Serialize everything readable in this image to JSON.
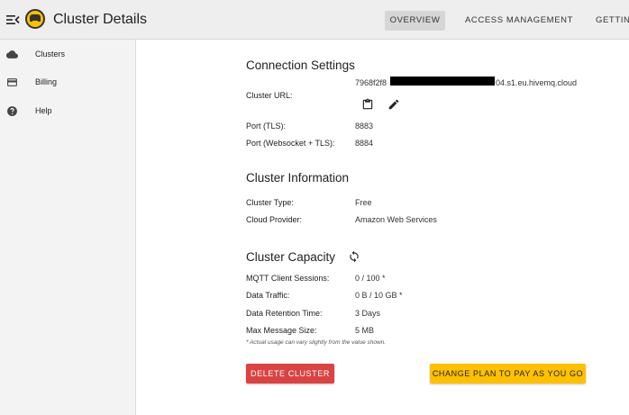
{
  "header": {
    "title": "Cluster Details",
    "tabs": [
      {
        "label": "OVERVIEW",
        "active": true
      },
      {
        "label": "ACCESS MANAGEMENT",
        "active": false
      },
      {
        "label": "GETTIN",
        "active": false
      }
    ]
  },
  "sidebar": {
    "items": [
      {
        "label": "Clusters",
        "icon": "cloud-icon"
      },
      {
        "label": "Billing",
        "icon": "credit-card-icon"
      },
      {
        "label": "Help",
        "icon": "help-icon"
      }
    ]
  },
  "connection": {
    "title": "Connection Settings",
    "cluster_url_label": "Cluster URL:",
    "cluster_url_prefix": "7968f2f8",
    "cluster_url_suffix": "04.s1.eu.hivemq.cloud",
    "port_tls_label": "Port (TLS):",
    "port_tls_value": "8883",
    "port_ws_label": "Port (Websocket + TLS):",
    "port_ws_value": "8884"
  },
  "information": {
    "title": "Cluster Information",
    "type_label": "Cluster Type:",
    "type_value": "Free",
    "provider_label": "Cloud Provider:",
    "provider_value": "Amazon Web Services"
  },
  "capacity": {
    "title": "Cluster Capacity",
    "sessions_label": "MQTT Client Sessions:",
    "sessions_value": "0 / 100 *",
    "traffic_label": "Data Traffic:",
    "traffic_value": "0 B / 10 GB *",
    "retention_label": "Data Retention Time:",
    "retention_value": "3 Days",
    "max_msg_label": "Max Message Size:",
    "max_msg_value": "5 MB",
    "note": "* Actual usage can vary slightly from the value shown."
  },
  "actions": {
    "delete_label": "DELETE CLUSTER",
    "change_plan_label": "CHANGE PLAN TO PAY AS YOU GO"
  },
  "colors": {
    "delete": "#d94343",
    "change_plan": "#ffc000",
    "brand": "#ffc000"
  }
}
